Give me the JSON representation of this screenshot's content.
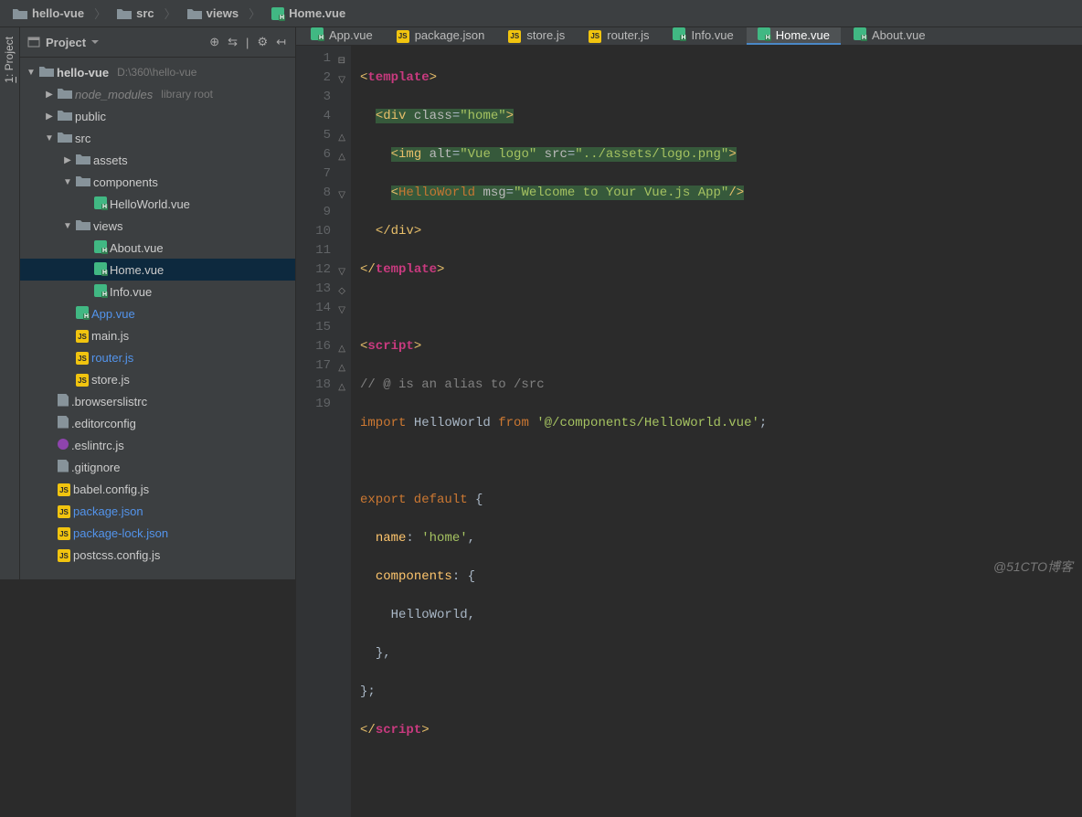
{
  "breadcrumb": [
    "hello-vue",
    "src",
    "views",
    "Home.vue"
  ],
  "sidebar_tab": "1: Project",
  "panel": {
    "title": "Project",
    "tools": [
      "⊕",
      "⇆",
      "|",
      "⚙",
      "↤"
    ]
  },
  "tree": [
    {
      "depth": 0,
      "arrow": "▼",
      "icon": "folder",
      "label": "hello-vue",
      "sublabel": "D:\\360\\hello-vue",
      "bold": true
    },
    {
      "depth": 1,
      "arrow": "▶",
      "icon": "folder",
      "label": "node_modules",
      "sublabel": "library root",
      "dim": true
    },
    {
      "depth": 1,
      "arrow": "▶",
      "icon": "folder",
      "label": "public"
    },
    {
      "depth": 1,
      "arrow": "▼",
      "icon": "folder",
      "label": "src"
    },
    {
      "depth": 2,
      "arrow": "▶",
      "icon": "folder",
      "label": "assets"
    },
    {
      "depth": 2,
      "arrow": "▼",
      "icon": "folder",
      "label": "components"
    },
    {
      "depth": 3,
      "arrow": "",
      "icon": "vueh",
      "label": "HelloWorld.vue"
    },
    {
      "depth": 2,
      "arrow": "▼",
      "icon": "folder",
      "label": "views"
    },
    {
      "depth": 3,
      "arrow": "",
      "icon": "vueh",
      "label": "About.vue"
    },
    {
      "depth": 3,
      "arrow": "",
      "icon": "vueh",
      "label": "Home.vue",
      "selected": true
    },
    {
      "depth": 3,
      "arrow": "",
      "icon": "vueh",
      "label": "Info.vue"
    },
    {
      "depth": 2,
      "arrow": "",
      "icon": "vueh",
      "label": "App.vue",
      "link": true
    },
    {
      "depth": 2,
      "arrow": "",
      "icon": "js",
      "label": "main.js"
    },
    {
      "depth": 2,
      "arrow": "",
      "icon": "js",
      "label": "router.js",
      "link": true
    },
    {
      "depth": 2,
      "arrow": "",
      "icon": "js",
      "label": "store.js"
    },
    {
      "depth": 1,
      "arrow": "",
      "icon": "file",
      "label": ".browserslistrc"
    },
    {
      "depth": 1,
      "arrow": "",
      "icon": "file",
      "label": ".editorconfig"
    },
    {
      "depth": 1,
      "arrow": "",
      "icon": "purple",
      "label": ".eslintrc.js"
    },
    {
      "depth": 1,
      "arrow": "",
      "icon": "file",
      "label": ".gitignore"
    },
    {
      "depth": 1,
      "arrow": "",
      "icon": "js",
      "label": "babel.config.js"
    },
    {
      "depth": 1,
      "arrow": "",
      "icon": "js",
      "label": "package.json",
      "link": true
    },
    {
      "depth": 1,
      "arrow": "",
      "icon": "js",
      "label": "package-lock.json",
      "link": true
    },
    {
      "depth": 1,
      "arrow": "",
      "icon": "js",
      "label": "postcss.config.js"
    }
  ],
  "tabs": [
    {
      "icon": "vueh",
      "label": "App.vue"
    },
    {
      "icon": "js",
      "label": "package.json"
    },
    {
      "icon": "js",
      "label": "store.js"
    },
    {
      "icon": "js",
      "label": "router.js"
    },
    {
      "icon": "vueh",
      "label": "Info.vue"
    },
    {
      "icon": "vueh",
      "label": "Home.vue",
      "active": true
    },
    {
      "icon": "vueh",
      "label": "About.vue"
    }
  ],
  "code_lines": 19,
  "watermark": "@51CTO博客"
}
